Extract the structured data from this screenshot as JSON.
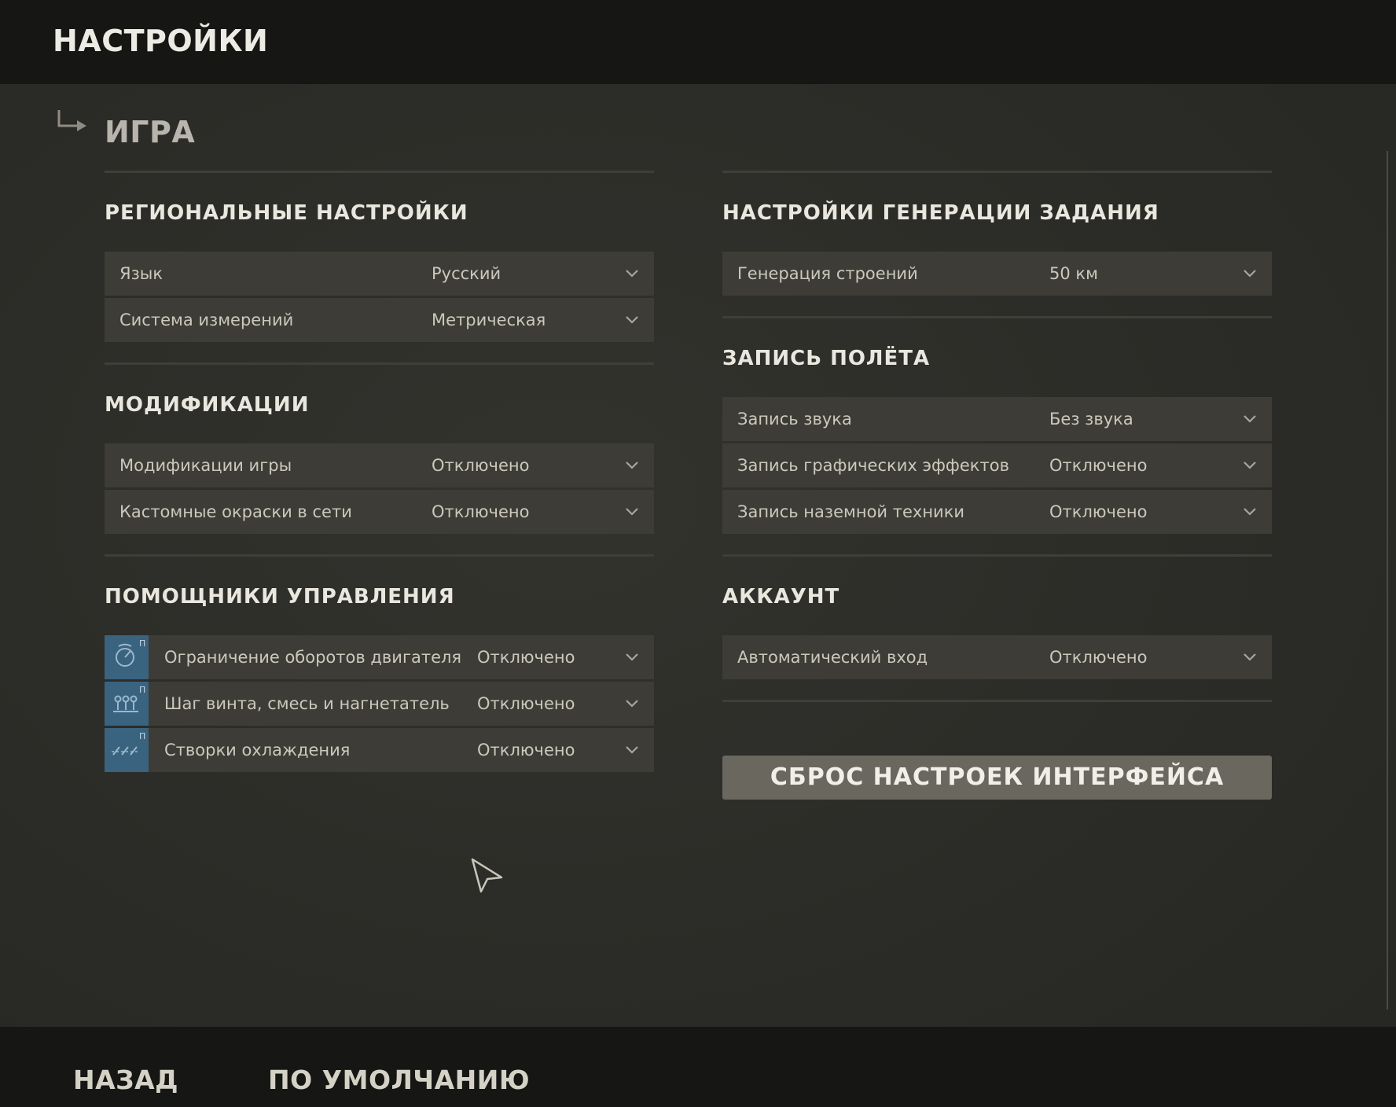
{
  "header": {
    "title": "НАСТРОЙКИ"
  },
  "section": {
    "title": "ИГРА"
  },
  "left": {
    "regional": {
      "title": "РЕГИОНАЛЬНЫЕ НАСТРОЙКИ",
      "rows": [
        {
          "label": "Язык",
          "value": "Русский"
        },
        {
          "label": "Система измерений",
          "value": "Метрическая"
        }
      ]
    },
    "mods": {
      "title": "МОДИФИКАЦИИ",
      "rows": [
        {
          "label": "Модификации игры",
          "value": "Отключено"
        },
        {
          "label": "Кастомные окраски в сети",
          "value": "Отключено"
        }
      ]
    },
    "assists": {
      "title": "ПОМОЩНИКИ УПРАВЛЕНИЯ",
      "rows": [
        {
          "label": "Ограничение оборотов двигателя",
          "value": "Отключено",
          "badge": "П",
          "icon": "rpm-limit-icon"
        },
        {
          "label": "Шаг винта, смесь и нагнетатель",
          "value": "Отключено",
          "badge": "П",
          "icon": "throttle-levers-icon"
        },
        {
          "label": "Створки охлаждения",
          "value": "Отключено",
          "badge": "П",
          "icon": "cowl-flaps-icon"
        }
      ]
    }
  },
  "right": {
    "mission_gen": {
      "title": "НАСТРОЙКИ ГЕНЕРАЦИИ ЗАДАНИЯ",
      "rows": [
        {
          "label": "Генерация строений",
          "value": "50 км"
        }
      ]
    },
    "flight_record": {
      "title": "ЗАПИСЬ ПОЛЁТА",
      "rows": [
        {
          "label": "Запись звука",
          "value": "Без звука"
        },
        {
          "label": "Запись графических эффектов",
          "value": "Отключено"
        },
        {
          "label": "Запись наземной техники",
          "value": "Отключено"
        }
      ]
    },
    "account": {
      "title": "АККАУНТ",
      "rows": [
        {
          "label": "Автоматический вход",
          "value": "Отключено"
        }
      ]
    },
    "reset_label": "СБРОС НАСТРОЕК ИНТЕРФЕЙСА"
  },
  "footer": {
    "back_label": "НАЗАД",
    "default_label": "ПО УМОЛЧАНИЮ"
  },
  "colors": {
    "row_bg": "#3d3c36",
    "badge_bg": "#3a6380",
    "bar_bg": "#161614",
    "button_bg": "#6a685e"
  }
}
